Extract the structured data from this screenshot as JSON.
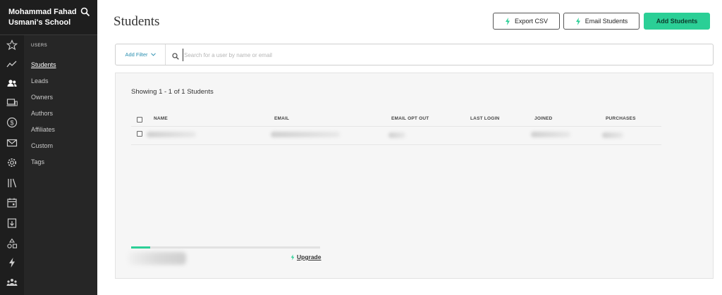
{
  "school": {
    "name": "Mohammad Fahad Usmani's School"
  },
  "nav": {
    "section_label": "USERS",
    "items": [
      {
        "label": "Students",
        "active": true
      },
      {
        "label": "Leads"
      },
      {
        "label": "Owners"
      },
      {
        "label": "Authors"
      },
      {
        "label": "Affiliates"
      },
      {
        "label": "Custom"
      },
      {
        "label": "Tags"
      }
    ]
  },
  "rail_icons": [
    "star-icon",
    "trend-icon",
    "users-icon",
    "devices-icon",
    "dollar-icon",
    "mail-icon",
    "gear-icon",
    "library-icon",
    "calendar-icon",
    "download-doc-icon",
    "shapes-icon",
    "bolt-icon",
    "community-icon"
  ],
  "header": {
    "title": "Students",
    "export_label": "Export CSV",
    "email_label": "Email Students",
    "add_label": "Add Students"
  },
  "search": {
    "filter_label": "Add Filter",
    "placeholder": "Search for a user by name or email"
  },
  "table": {
    "showing": "Showing 1 - 1 of 1 Students",
    "columns": [
      "NAME",
      "EMAIL",
      "EMAIL OPT OUT",
      "LAST LOGIN",
      "JOINED",
      "PURCHASES"
    ]
  },
  "footer": {
    "progress_fraction": 0.1,
    "upgrade_label": "Upgrade"
  },
  "colors": {
    "accent": "#2bcf96",
    "sidebar_bg": "#1e1e1e",
    "link": "#2a8fb0"
  }
}
